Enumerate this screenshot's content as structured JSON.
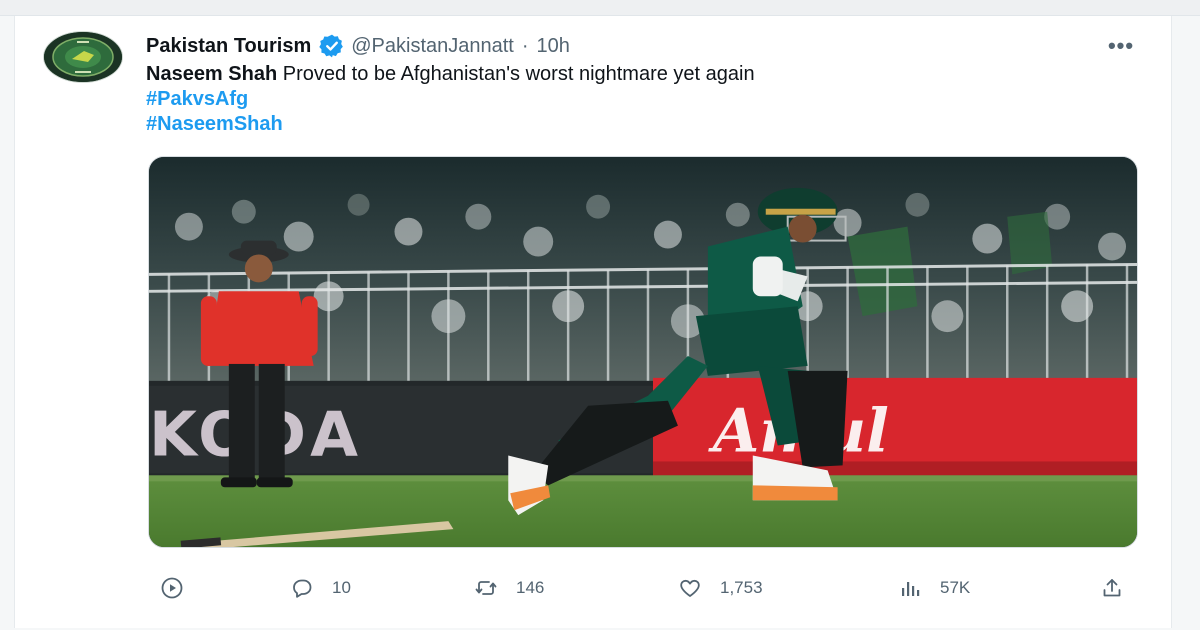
{
  "tweet": {
    "author": {
      "display_name": "Pakistan Tourism",
      "handle": "@PakistanJannatt",
      "separator": "·",
      "time": "10h"
    },
    "more_label": "•••",
    "text": {
      "mention": "Naseem Shah",
      "body": " Proved to be Afghanistan's worst nightmare yet again",
      "hashtags": [
        "#PakvsAfg",
        "#NaseemShah"
      ]
    },
    "media": {
      "banner_left": "KODA",
      "banner_right": "Amul"
    },
    "stats": {
      "replies": "10",
      "retweets": "146",
      "likes": "1,753",
      "views": "57K"
    },
    "icons": {
      "play": "play-circle-icon",
      "reply": "speech-bubble-icon",
      "retweet": "retweet-arrows-icon",
      "like": "heart-icon",
      "views": "bar-chart-icon",
      "share": "share-upload-icon",
      "verified": "verified-badge-icon"
    },
    "colors": {
      "accent": "#1d9bf0",
      "secondary_text": "#536471",
      "jersey": "#0e5a46",
      "umpire_shirt": "#e0322a",
      "banner_red": "#d8262d"
    }
  }
}
